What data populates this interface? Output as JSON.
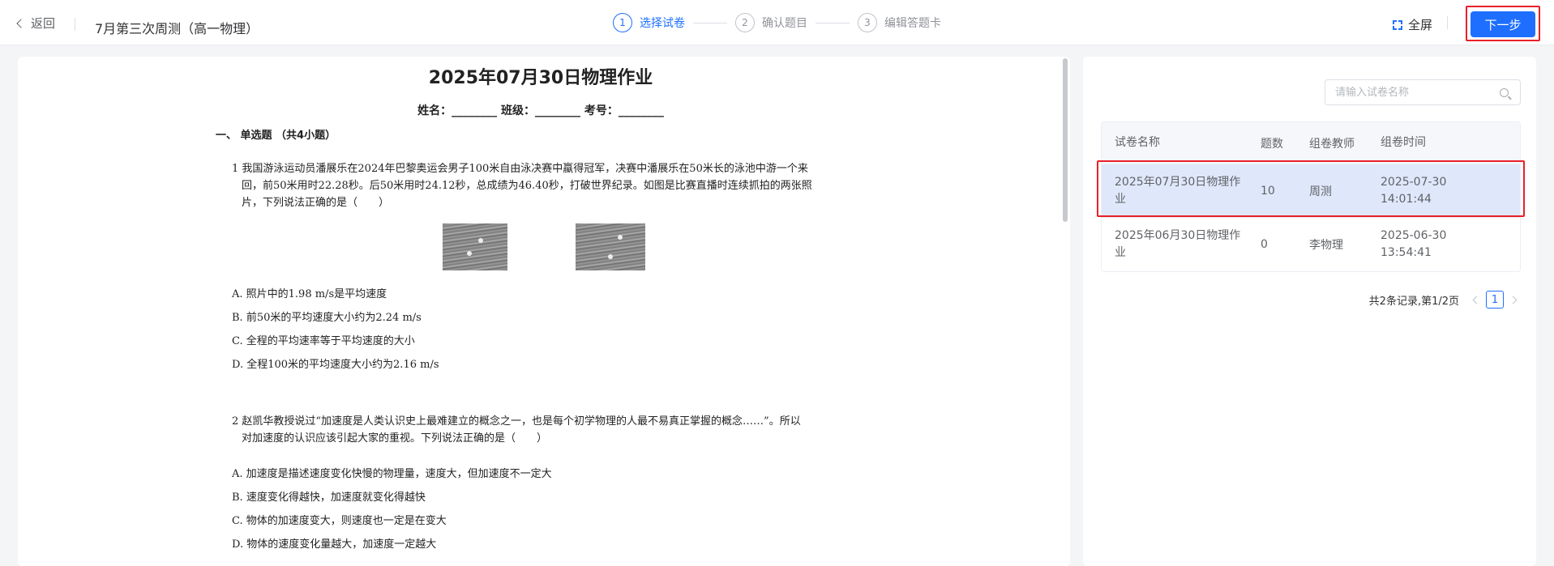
{
  "header": {
    "back_label": "返回",
    "exam_title": "7月第三次周测（高一物理）",
    "steps": [
      {
        "num": "1",
        "label": "选择试卷"
      },
      {
        "num": "2",
        "label": "确认题目"
      },
      {
        "num": "3",
        "label": "编辑答题卡"
      }
    ],
    "fullscreen_label": "全屏",
    "next_label": "下一步"
  },
  "preview": {
    "title": "2025年07月30日物理作业",
    "subtitle": "姓名：________ 班级：________ 考号：________",
    "section": "一、 单选题 （共4小题）",
    "questions": [
      {
        "lines": [
          "1 我国游泳运动员潘展乐在2024年巴黎奥运会男子100米自由泳决赛中蠃得冠军，决赛中潘展乐在50米长的泳池中游一个来",
          "回，前50米用时22.28秒。后50米用时24.12秒，总成绩为46.40秒，打破世界纪录。如图是比赛直播时连续抓拍的两张照",
          "片，下列说法正确的是（　　）"
        ],
        "options": [
          "A. 照片中的1.98 m/s是平均速度",
          "B. 前50米的平均速度大小约为2.24 m/s",
          "C. 全程的平均速率等于平均速度的大小",
          "D. 全程100米的平均速度大小约为2.16 m/s"
        ]
      },
      {
        "lines": [
          "2 赵凯华教授说过“加速度是人类认识史上最难建立的概念之一，也是每个初学物理的人最不易真正掌握的概念……”。所以",
          "对加速度的认识应该引起大家的重视。下列说法正确的是（　　）"
        ],
        "options": [
          "A. 加速度是描述速度变化快慢的物理量，速度大，但加速度不一定大",
          "B. 速度变化得越快，加速度就变化得越快",
          "C. 物体的加速度变大，则速度也一定是在变大",
          "D. 物体的速度变化量越大，加速度一定越大"
        ]
      }
    ]
  },
  "paper_list": {
    "search_placeholder": "请输入试卷名称",
    "columns": [
      "试卷名称",
      "题数",
      "组卷教师",
      "组卷时间"
    ],
    "rows": [
      {
        "name_line1": "2025年07月30日物理作",
        "name_line2": "业",
        "count": "10",
        "teacher": "周测",
        "date": "2025-07-30",
        "time": "14:01:44"
      },
      {
        "name_line1": "2025年06月30日物理作",
        "name_line2": "业",
        "count": "0",
        "teacher": "李物理",
        "date": "2025-06-30",
        "time": "13:54:41"
      }
    ],
    "pagination_text": "共2条记录,第1/2页",
    "current_page": "1"
  },
  "colors": {
    "primary": "#1e6fff",
    "highlight_outline": "#e8202a",
    "selected_row": "#dfe8fb"
  }
}
